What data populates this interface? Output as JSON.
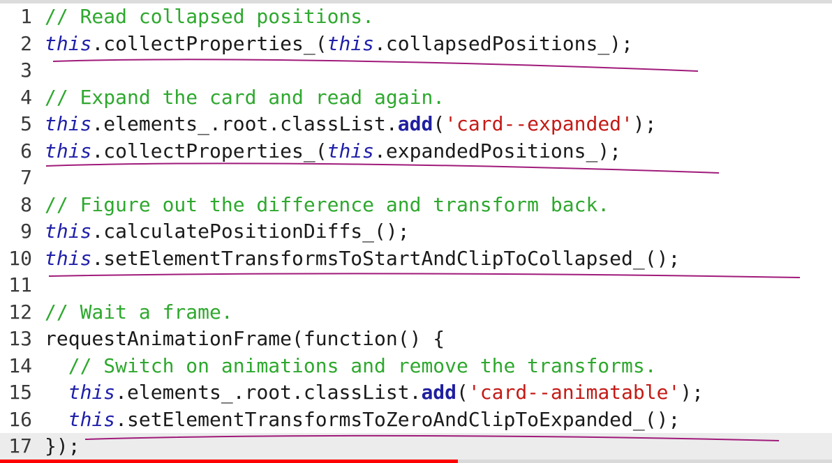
{
  "colors": {
    "comment": "#2ea82e",
    "keyword": "#1f1faa",
    "string": "#c41a16",
    "underline": "#a01a7a",
    "progress": "#ff0000"
  },
  "lines": [
    {
      "n": "1",
      "tokens": [
        {
          "t": "comment",
          "v": "// Read collapsed positions."
        }
      ]
    },
    {
      "n": "2",
      "tokens": [
        {
          "t": "kw",
          "v": "this"
        },
        {
          "t": "plain",
          "v": ".collectProperties_("
        },
        {
          "t": "kw",
          "v": "this"
        },
        {
          "t": "plain",
          "v": ".collapsedPositions_);"
        }
      ]
    },
    {
      "n": "3",
      "tokens": []
    },
    {
      "n": "4",
      "tokens": [
        {
          "t": "comment",
          "v": "// Expand the card and read again."
        }
      ]
    },
    {
      "n": "5",
      "tokens": [
        {
          "t": "kw",
          "v": "this"
        },
        {
          "t": "plain",
          "v": ".elements_.root.classList."
        },
        {
          "t": "fn",
          "v": "add"
        },
        {
          "t": "plain",
          "v": "("
        },
        {
          "t": "str",
          "v": "'card--expanded'"
        },
        {
          "t": "plain",
          "v": ");"
        }
      ]
    },
    {
      "n": "6",
      "tokens": [
        {
          "t": "kw",
          "v": "this"
        },
        {
          "t": "plain",
          "v": ".collectProperties_("
        },
        {
          "t": "kw",
          "v": "this"
        },
        {
          "t": "plain",
          "v": ".expandedPositions_);"
        }
      ]
    },
    {
      "n": "7",
      "tokens": []
    },
    {
      "n": "8",
      "tokens": [
        {
          "t": "comment",
          "v": "// Figure out the difference and transform back."
        }
      ]
    },
    {
      "n": "9",
      "tokens": [
        {
          "t": "kw",
          "v": "this"
        },
        {
          "t": "plain",
          "v": ".calculatePositionDiffs_();"
        }
      ]
    },
    {
      "n": "10",
      "tokens": [
        {
          "t": "kw",
          "v": "this"
        },
        {
          "t": "plain",
          "v": ".setElementTransformsToStartAndClipToCollapsed_();"
        }
      ]
    },
    {
      "n": "11",
      "tokens": []
    },
    {
      "n": "12",
      "tokens": [
        {
          "t": "comment",
          "v": "// Wait a frame."
        }
      ]
    },
    {
      "n": "13",
      "tokens": [
        {
          "t": "plain",
          "v": "requestAnimationFrame(function() {"
        }
      ]
    },
    {
      "n": "14",
      "tokens": [
        {
          "t": "plain",
          "v": "  "
        },
        {
          "t": "comment",
          "v": "// Switch on animations and remove the transforms."
        }
      ]
    },
    {
      "n": "15",
      "tokens": [
        {
          "t": "plain",
          "v": "  "
        },
        {
          "t": "kw",
          "v": "this"
        },
        {
          "t": "plain",
          "v": ".elements_.root.classList."
        },
        {
          "t": "fn",
          "v": "add"
        },
        {
          "t": "plain",
          "v": "("
        },
        {
          "t": "str",
          "v": "'card--animatable'"
        },
        {
          "t": "plain",
          "v": ");"
        }
      ]
    },
    {
      "n": "16",
      "tokens": [
        {
          "t": "plain",
          "v": "  "
        },
        {
          "t": "kw",
          "v": "this"
        },
        {
          "t": "plain",
          "v": ".setElementTransformsToZeroAndClipToExpanded_();"
        }
      ]
    },
    {
      "n": "17",
      "tokens": [
        {
          "t": "plain",
          "v": "});"
        }
      ],
      "current": true
    }
  ],
  "video_progress_fraction": 0.55
}
